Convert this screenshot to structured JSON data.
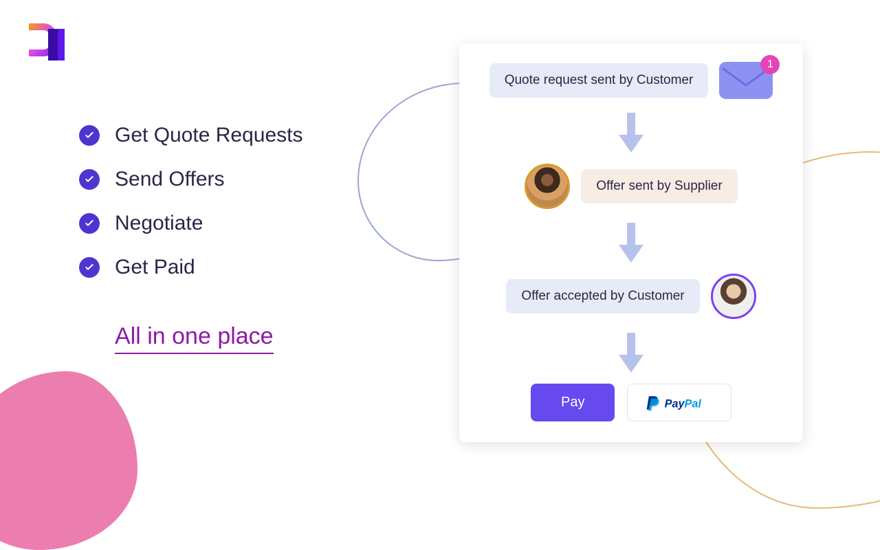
{
  "features": [
    "Get Quote Requests",
    "Send Offers",
    "Negotiate",
    "Get Paid"
  ],
  "tagline": "All in one place",
  "flow": {
    "step1": "Quote request sent by Customer",
    "step2": "Offer sent by Supplier",
    "step3": "Offer accepted by Customer",
    "notification_count": "1",
    "pay_label": "Pay",
    "paypal_label": "PayPal"
  }
}
